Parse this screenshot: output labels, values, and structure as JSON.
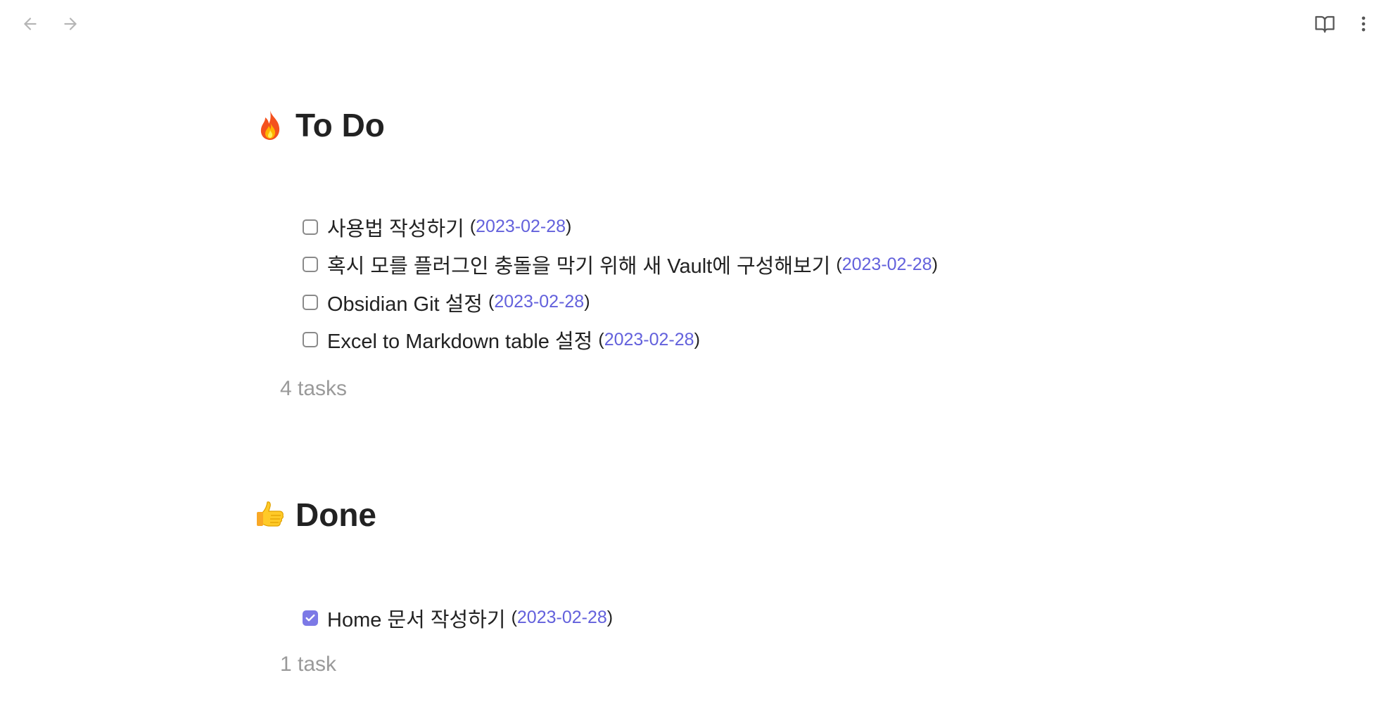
{
  "toolbar": {
    "back_icon": "arrow-left-icon",
    "forward_icon": "arrow-right-icon",
    "reading_view_icon": "book-open-icon",
    "more_options_icon": "more-vertical-icon"
  },
  "sections": [
    {
      "emoji": "fire-emoji",
      "title": "To Do",
      "tasks": [
        {
          "text": "사용법 작성하기",
          "date": "2023-02-28",
          "checked": false
        },
        {
          "text": "혹시 모를 플러그인 충돌을 막기 위해 새 Vault에 구성해보기",
          "date": "2023-02-28",
          "checked": false
        },
        {
          "text": "Obsidian Git 설정",
          "date": "2023-02-28",
          "checked": false
        },
        {
          "text": "Excel to Markdown table 설정",
          "date": "2023-02-28",
          "checked": false
        }
      ],
      "count_label": "4 tasks"
    },
    {
      "emoji": "thumbs-up-emoji",
      "title": "Done",
      "tasks": [
        {
          "text": "Home 문서 작성하기",
          "date": "2023-02-28",
          "checked": true
        }
      ],
      "count_label": "1 task"
    }
  ],
  "punctuation": {
    "open": "(",
    "close": ")"
  },
  "colors": {
    "accent": "#7c79e6",
    "link": "#6361dc",
    "muted": "#9a9a9a",
    "text": "#222222"
  }
}
